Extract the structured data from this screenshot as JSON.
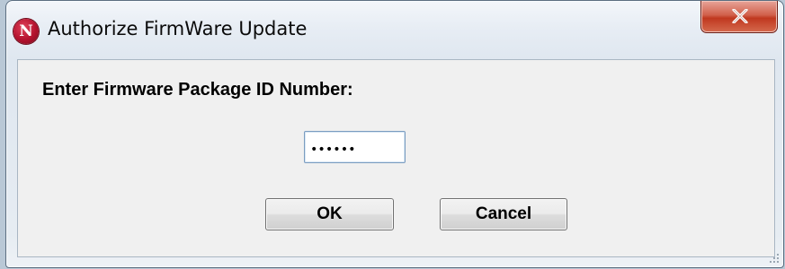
{
  "window": {
    "title": "Authorize FirmWare Update",
    "icon_letter": "N",
    "icon": "app-logo-icon",
    "close_icon": "close-icon"
  },
  "dialog": {
    "prompt_label": "Enter Firmware Package ID Number:",
    "package_id_value": "••••••",
    "ok_label": "OK",
    "cancel_label": "Cancel"
  },
  "colors": {
    "close_button": "#c0381f",
    "app_icon": "#b3122e",
    "input_border": "#7a9cc0"
  }
}
